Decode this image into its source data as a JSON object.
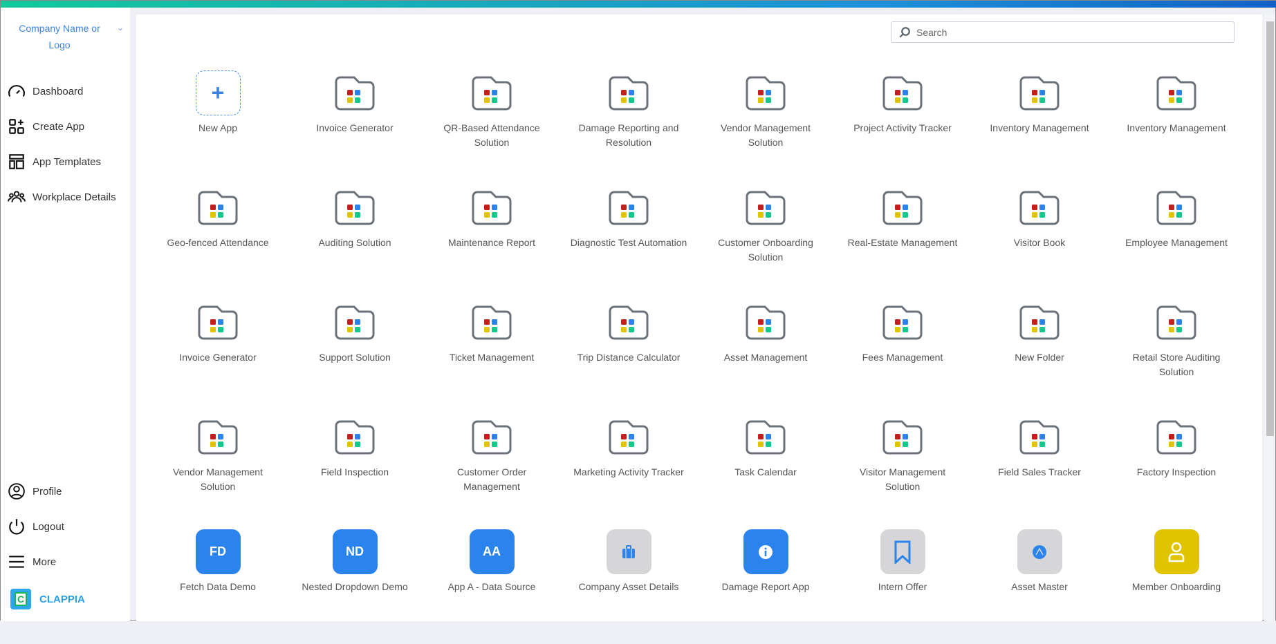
{
  "sidebar": {
    "company": "Company Name or Logo",
    "items": [
      {
        "label": "Dashboard",
        "icon": "gauge-icon"
      },
      {
        "label": "Create App",
        "icon": "create-app-icon"
      },
      {
        "label": "App Templates",
        "icon": "templates-icon"
      },
      {
        "label": "Workplace Details",
        "icon": "users-icon"
      }
    ],
    "bottom": [
      {
        "label": "Profile",
        "icon": "profile-icon"
      },
      {
        "label": "Logout",
        "icon": "power-icon"
      },
      {
        "label": "More",
        "icon": "menu-icon"
      }
    ],
    "brand": "CLAPPIA",
    "brand_letter": "C"
  },
  "search": {
    "placeholder": "Search"
  },
  "new_app": {
    "label": "New App"
  },
  "folders": [
    "Invoice Generator",
    "QR-Based Attendance Solution",
    "Damage Reporting and Resolution",
    "Vendor Management Solution",
    "Project Activity Tracker",
    "Inventory Management",
    "Inventory Management",
    "Geo-fenced Attendance",
    "Auditing Solution",
    "Maintenance Report",
    "Diagnostic Test Automation",
    "Customer Onboarding Solution",
    "Real-Estate Management",
    "Visitor Book",
    "Employee Management",
    "Invoice Generator",
    "Support Solution",
    "Ticket Management",
    "Trip Distance Calculator",
    "Asset Management",
    "Fees Management",
    "New Folder",
    "Retail Store Auditing Solution",
    "Vendor Management Solution",
    "Field Inspection",
    "Customer Order Management",
    "Marketing Activity Tracker",
    "Task Calendar",
    "Visitor Management Solution",
    "Field Sales Tracker",
    "Factory Inspection"
  ],
  "apps": [
    {
      "label": "Fetch Data Demo",
      "initials": "FD",
      "color": "#2b84ee"
    },
    {
      "label": "Nested Dropdown Demo",
      "initials": "ND",
      "color": "#2b84ee"
    },
    {
      "label": "App A - Data Source",
      "initials": "AA",
      "color": "#2b84ee"
    },
    {
      "label": "Company Asset Details",
      "icon": "briefcase-icon",
      "color": "#d6d6d8"
    },
    {
      "label": "Damage Report App",
      "icon": "info-icon",
      "color": "#2b84ee"
    },
    {
      "label": "Intern Offer",
      "icon": "bookmark-icon",
      "color": "#d6d6d8"
    },
    {
      "label": "Asset Master",
      "icon": "compass-icon",
      "color": "#d6d6d8"
    },
    {
      "label": "Member Onboarding",
      "icon": "person-icon",
      "color": "#e0c400"
    }
  ]
}
